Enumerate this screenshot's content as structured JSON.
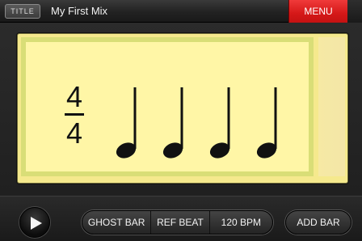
{
  "header": {
    "title_chip": "TITLE",
    "song_name": "My First Mix",
    "menu_label": "MENU"
  },
  "bar": {
    "time_signature": {
      "numerator": "4",
      "denominator": "4"
    },
    "notes": [
      "quarter-note",
      "quarter-note",
      "quarter-note",
      "quarter-note"
    ]
  },
  "footer": {
    "play_icon": "play-icon",
    "ghost_bar_label": "GHOST BAR",
    "ref_beat_label": "REF BEAT",
    "bpm_label": "120 BPM",
    "add_bar_label": "ADD BAR"
  },
  "colors": {
    "menu_red": "#d51818",
    "bar_yellow": "#fff6a6",
    "bar_border": "#d9de77"
  }
}
